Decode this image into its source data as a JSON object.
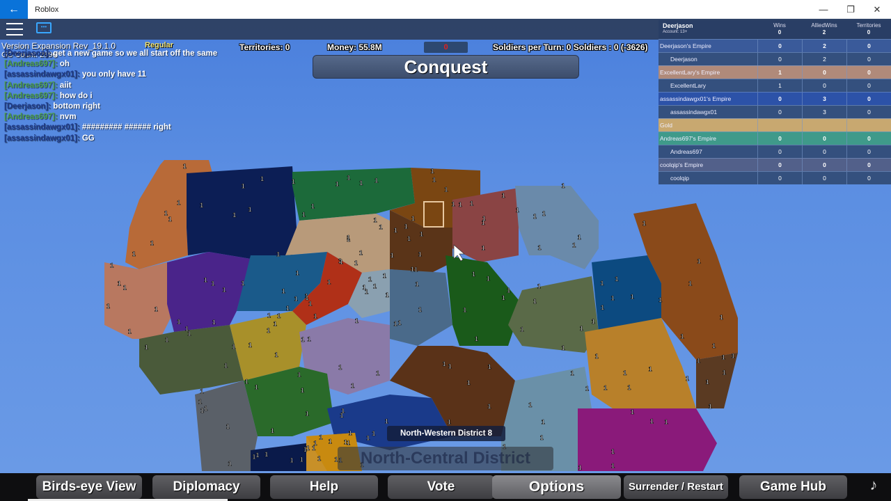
{
  "window": {
    "app_title": "Roblox",
    "back_icon": "arrow-left-icon",
    "minimize_icon": "minimize-icon",
    "maximize_icon": "maximize-icon",
    "close_icon": "close-icon",
    "back_glyph": "←",
    "minimize_glyph": "—",
    "maximize_glyph": "❐",
    "close_glyph": "✕"
  },
  "topbar": {
    "menu_icon": "hamburger-menu-icon",
    "chat_icon": "chat-bubble-icon",
    "chat_glyph": "•••"
  },
  "overlay": {
    "version": "Version Expansion Rev_19.1.0",
    "gc_count": "GC Count: 2896",
    "rank": "Regular"
  },
  "chat": [
    {
      "name": "[Deerjason]:",
      "name_color": "dark",
      "message": "get a new game so we all start off the same"
    },
    {
      "name": "[Andreas697]:",
      "name_color": "green",
      "message": "oh"
    },
    {
      "name": "[assassindawgx01]:",
      "name_color": "dark",
      "message": "you only have 11"
    },
    {
      "name": "[Andreas697]:",
      "name_color": "green",
      "message": "aiit"
    },
    {
      "name": "[Andreas697]:",
      "name_color": "green",
      "message": "how do i"
    },
    {
      "name": "[Deerjason]:",
      "name_color": "dark",
      "message": "bottom right"
    },
    {
      "name": "[Andreas697]:",
      "name_color": "green",
      "message": "nvm"
    },
    {
      "name": "[assassindawgx01]:",
      "name_color": "dark",
      "message": "######### ###### right"
    },
    {
      "name": "[assassindawgx01]:",
      "name_color": "dark",
      "message": "GG"
    }
  ],
  "stats": {
    "territories": "Territories: 0",
    "money": "Money: 55.8M",
    "timer": "0",
    "soldiers": "Soldiers per Turn: 0 Soldiers : 0 (-3626)"
  },
  "game_mode": "Conquest",
  "leaderboard": {
    "player_name": "Deerjason",
    "account": "Account: 13+",
    "columns": [
      "Wins",
      "AlliedWins",
      "Territories"
    ],
    "player_totals": [
      "0",
      "2",
      "0"
    ],
    "rows": [
      {
        "name": "Deerjason's Empire",
        "type": "team",
        "color": "#3a5a9a",
        "values": [
          "0",
          "2",
          "0"
        ]
      },
      {
        "name": "Deerjason",
        "type": "player",
        "color": "#34507e",
        "values": [
          "0",
          "2",
          "0"
        ]
      },
      {
        "name": "ExcellentLary's Empire",
        "type": "team",
        "color": "#b08a7a",
        "values": [
          "1",
          "0",
          "0"
        ]
      },
      {
        "name": "ExcellentLary",
        "type": "player",
        "color": "#34507e",
        "values": [
          "1",
          "0",
          "0"
        ]
      },
      {
        "name": "assassindawgx01's Empire",
        "type": "team",
        "color": "#2c52a8",
        "values": [
          "0",
          "3",
          "0"
        ]
      },
      {
        "name": "assassindawgx01",
        "type": "player",
        "color": "#34507e",
        "values": [
          "0",
          "3",
          "0"
        ]
      },
      {
        "name": "Gold",
        "type": "team",
        "color": "#c8a870",
        "values": [
          "",
          "",
          ""
        ]
      },
      {
        "name": "Andreas697's Empire",
        "type": "team",
        "color": "#3f9a8a",
        "values": [
          "0",
          "0",
          "0"
        ]
      },
      {
        "name": "Andreas697",
        "type": "player",
        "color": "#34507e",
        "values": [
          "0",
          "0",
          "0"
        ]
      },
      {
        "name": "coolqip's Empire",
        "type": "team",
        "color": "#52608a",
        "values": [
          "0",
          "0",
          "0"
        ]
      },
      {
        "name": "coolqip",
        "type": "player",
        "color": "#34507e",
        "values": [
          "0",
          "0",
          "0"
        ]
      }
    ]
  },
  "map": {
    "territory_value": "1",
    "hover_district": "North-Western District 8",
    "selected_district": "North-Central District",
    "territories": [
      {
        "name": "west-orange",
        "color": "#b86a38"
      },
      {
        "name": "navy",
        "color": "#0c1e55"
      },
      {
        "name": "green-north",
        "color": "#1c6a3a"
      },
      {
        "name": "brown-north",
        "color": "#7a4612"
      },
      {
        "name": "maroon",
        "color": "#8a4444"
      },
      {
        "name": "slate-north",
        "color": "#6a8aaa"
      },
      {
        "name": "tan",
        "color": "#b89a7a"
      },
      {
        "name": "dark-brown",
        "color": "#5a3418"
      },
      {
        "name": "salmon",
        "color": "#b87860"
      },
      {
        "name": "purple",
        "color": "#4a248a"
      },
      {
        "name": "teal-blue",
        "color": "#1a5a8a"
      },
      {
        "name": "red",
        "color": "#b03018"
      },
      {
        "name": "grey-blue",
        "color": "#8aa0b0"
      },
      {
        "name": "steel-blue",
        "color": "#4a6a8a"
      },
      {
        "name": "forest-green",
        "color": "#1a5a1a"
      },
      {
        "name": "olive",
        "color": "#5a6a48"
      },
      {
        "name": "blue-east",
        "color": "#0c4a80"
      },
      {
        "name": "brown-east",
        "color": "#8a4a1a"
      },
      {
        "name": "olive-drab",
        "color": "#4a5a3a"
      },
      {
        "name": "mustard",
        "color": "#a8902a"
      },
      {
        "name": "lavender",
        "color": "#8a7aa8"
      },
      {
        "name": "green-mid",
        "color": "#2a6a2a"
      },
      {
        "name": "grey",
        "color": "#5a6068"
      },
      {
        "name": "royal-blue",
        "color": "#1a3a8a"
      },
      {
        "name": "chocolate",
        "color": "#5a3218"
      },
      {
        "name": "gold",
        "color": "#c89028"
      },
      {
        "name": "light-steel",
        "color": "#6a90a8"
      },
      {
        "name": "ochre",
        "color": "#b8802a"
      },
      {
        "name": "magenta",
        "color": "#8a1a7a"
      },
      {
        "name": "dark-brown-east",
        "color": "#5a3a22"
      },
      {
        "name": "navy-south",
        "color": "#0a1a4a"
      },
      {
        "name": "orange-south",
        "color": "#c88a10"
      }
    ]
  },
  "bottom_buttons": [
    {
      "label": "Birds-eye View",
      "name": "birds-eye-view-button",
      "active": false
    },
    {
      "label": "Diplomacy",
      "name": "diplomacy-button",
      "active": false
    },
    {
      "label": "Help",
      "name": "help-button",
      "active": false
    },
    {
      "label": "Vote",
      "name": "vote-button",
      "active": false
    },
    {
      "label": "Options",
      "name": "options-button",
      "active": true
    },
    {
      "label": "Surrender / Restart",
      "name": "surrender-restart-button",
      "active": false
    },
    {
      "label": "Game Hub",
      "name": "game-hub-button",
      "active": false
    }
  ],
  "bottom_icon": {
    "name": "guitar-icon",
    "glyph": "♪"
  }
}
